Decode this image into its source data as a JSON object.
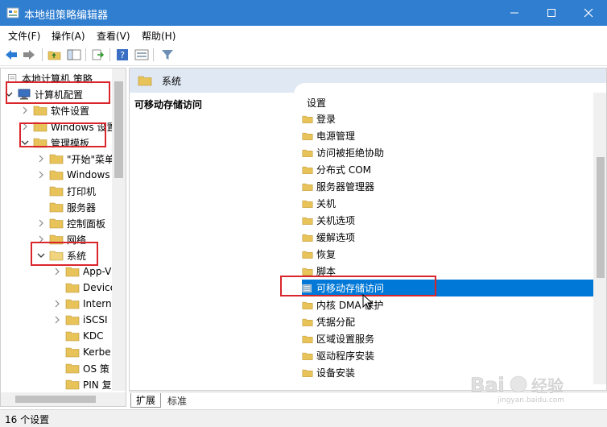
{
  "window": {
    "title": "本地组策略编辑器"
  },
  "menu": [
    "文件(F)",
    "操作(A)",
    "查看(V)",
    "帮助(H)"
  ],
  "tree": {
    "root": "本地计算机 策略",
    "computer_config": "计算机配置",
    "software": "软件设置",
    "windows_settings": "Windows 设置",
    "admin_templates": "管理模板",
    "start_menu": "\"开始\"菜单",
    "windows_components": "Windows",
    "printers": "打印机",
    "server": "服务器",
    "control_panel": "控制面板",
    "network": "网络",
    "system": "系统",
    "sub": [
      "App-V",
      "Device",
      "Interne",
      "iSCSI",
      "KDC",
      "Kerbe",
      "OS 策",
      "PIN 复"
    ]
  },
  "right": {
    "header": "系统",
    "desc_title": "可移动存储访问",
    "column_header": "设置",
    "items": [
      "登录",
      "电源管理",
      "访问被拒绝协助",
      "分布式 COM",
      "服务器管理器",
      "关机",
      "关机选项",
      "缓解选项",
      "恢复",
      "脚本",
      "可移动存储访问",
      "内核 DMA 保护",
      "凭据分配",
      "区域设置服务",
      "驱动程序安装",
      "设备安装"
    ],
    "selected_index": 10
  },
  "tabs": [
    "扩展",
    "标准"
  ],
  "status": "16 个设置",
  "watermark": {
    "brand": "Bai",
    "brand_cn": "经验",
    "url": "jingyan.baidu.com"
  },
  "colors": {
    "titlebar": "#2f7ed0",
    "selection": "#0078d7",
    "highlight_box": "#d9262c",
    "folder": "#e8c35a"
  }
}
